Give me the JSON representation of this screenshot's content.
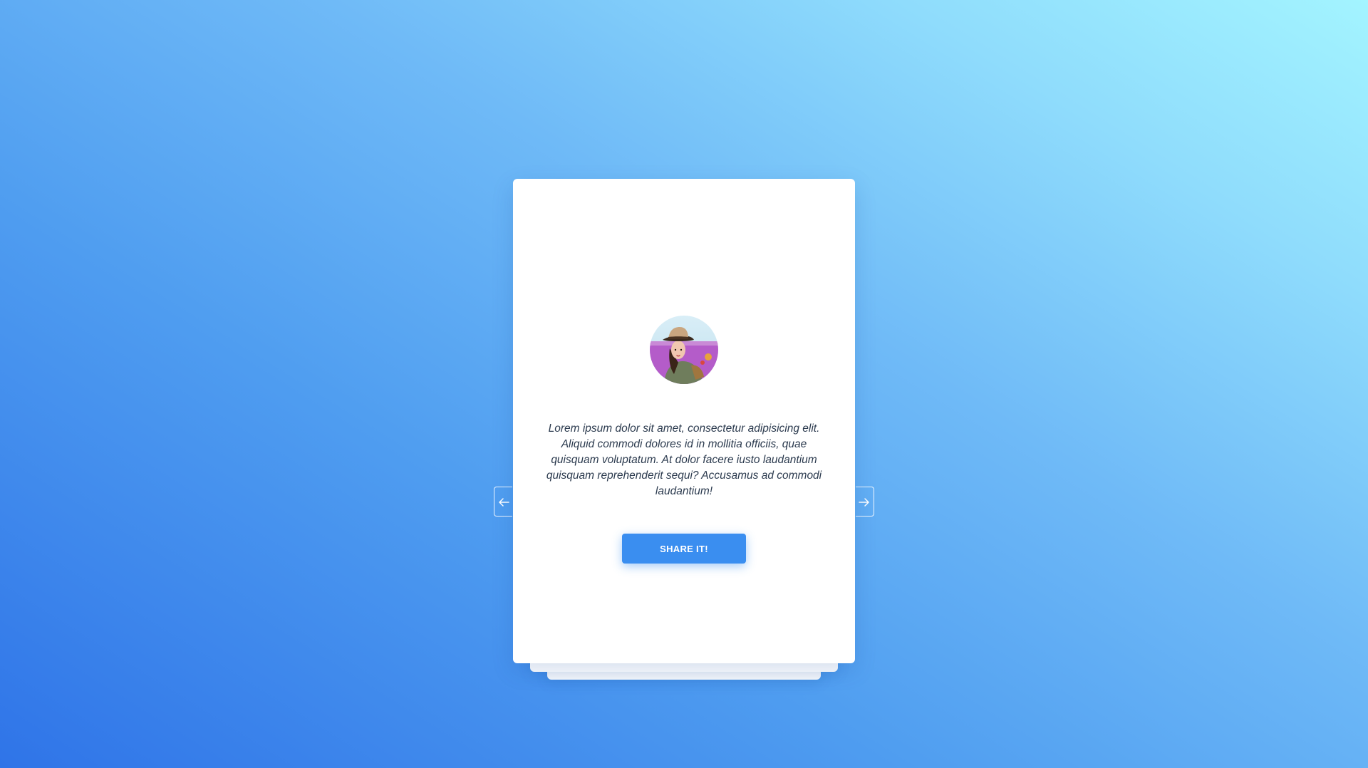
{
  "theme": {
    "accent": "#3a8ef0",
    "background_from": "#2f74e8",
    "background_to": "#a3f4ff",
    "card": "#ffffff",
    "text": "#2b3a4e"
  },
  "carousel": {
    "prev_icon": "arrow-left-icon",
    "next_icon": "arrow-right-icon"
  },
  "card": {
    "avatar_alt": "avatar",
    "quote": "Lorem ipsum dolor sit amet, consectetur adipisicing elit. Aliquid commodi dolores id in mollitia officiis, quae quisquam voluptatum. At dolor facere iusto laudantium quisquam reprehenderit sequi? Accusamus ad commodi laudantium!",
    "share_label": "SHARE IT!"
  }
}
